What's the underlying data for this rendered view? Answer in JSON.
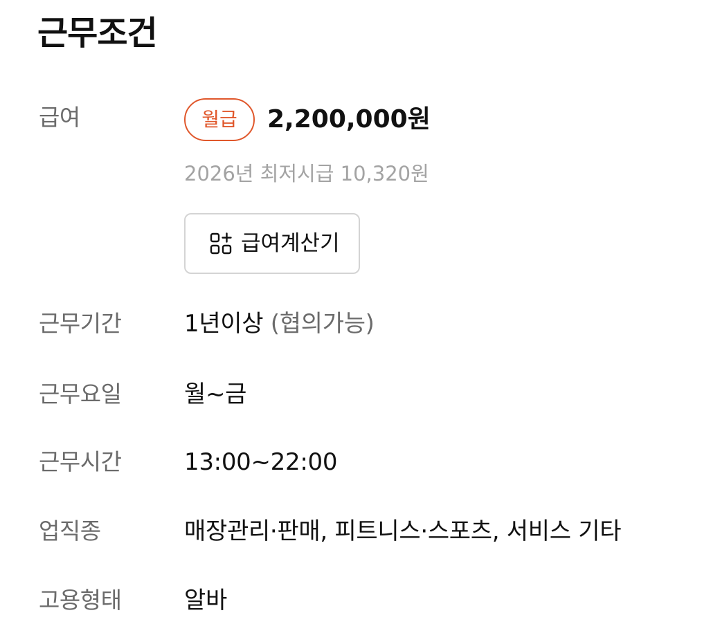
{
  "section": {
    "title": "근무조건"
  },
  "pay": {
    "label": "급여",
    "badge": "월급",
    "amount": "2,200,000원",
    "min_wage_note": "2026년 최저시급 10,320원",
    "calculator_button": "급여계산기"
  },
  "period": {
    "label": "근무기간",
    "value": "1년이상",
    "note": "(협의가능)"
  },
  "days": {
    "label": "근무요일",
    "value": "월~금"
  },
  "hours": {
    "label": "근무시간",
    "value": "13:00~22:00"
  },
  "category": {
    "label": "업직종",
    "value": "매장관리·판매, 피트니스·스포츠, 서비스 기타"
  },
  "employment": {
    "label": "고용형태",
    "value": "알바"
  },
  "colors": {
    "accent": "#e0572b",
    "label_gray": "#6b6b6b",
    "hint_gray": "#a3a3a3",
    "border_gray": "#d4d4d4"
  },
  "icons": {
    "calculator": "calculator-icon"
  }
}
